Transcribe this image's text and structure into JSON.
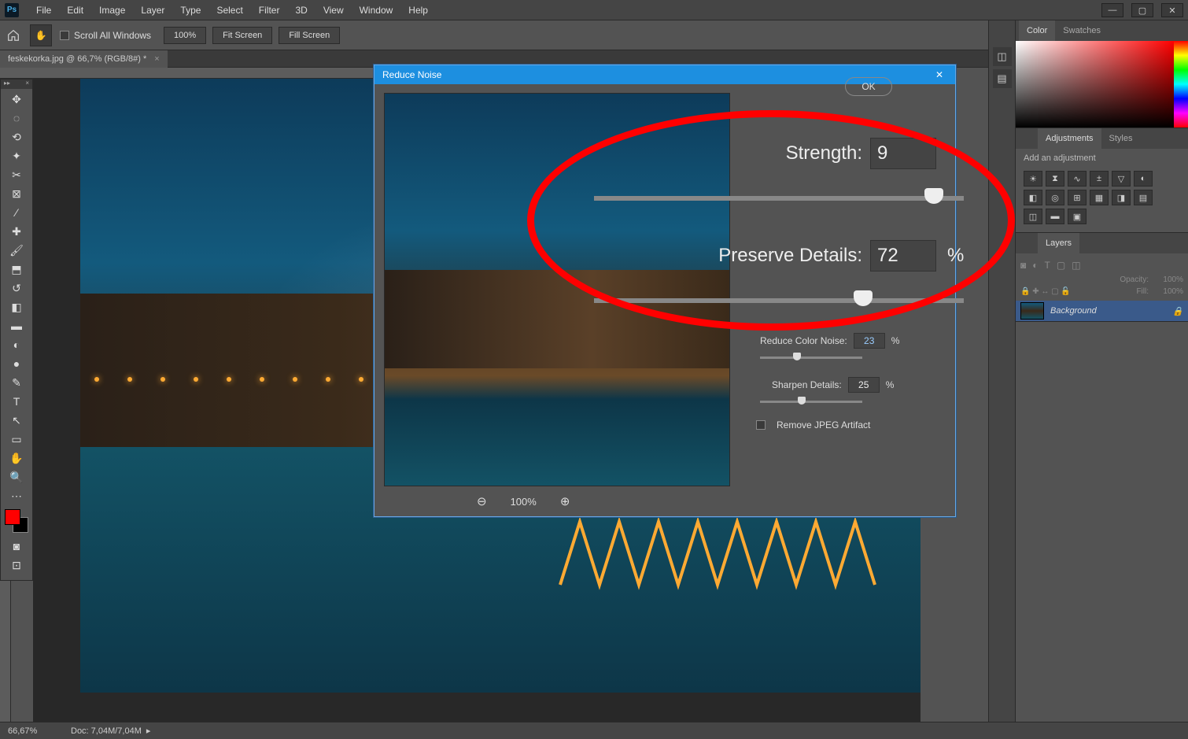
{
  "menu": {
    "items": [
      "File",
      "Edit",
      "Image",
      "Layer",
      "Type",
      "Select",
      "Filter",
      "3D",
      "View",
      "Window",
      "Help"
    ]
  },
  "options": {
    "scroll_all": "Scroll All Windows",
    "zoom": "100%",
    "fit": "Fit Screen",
    "fill": "Fill Screen"
  },
  "doc": {
    "tab": "feskekorka.jpg @ 66,7% (RGB/8#) *"
  },
  "dialog": {
    "title": "Reduce Noise",
    "ok": "OK",
    "strength_label": "Strength:",
    "strength_val": "9",
    "preserve_label": "Preserve Details:",
    "preserve_val": "72",
    "preserve_unit": "%",
    "colornoise_label": "Reduce Color Noise:",
    "colornoise_val": "23",
    "colornoise_unit": "%",
    "sharpen_label": "Sharpen Details:",
    "sharpen_val": "25",
    "sharpen_unit": "%",
    "removejpeg": "Remove JPEG Artifact",
    "zoom": "100%"
  },
  "panels": {
    "color": "Color",
    "swatches": "Swatches",
    "adjustments": "Adjustments",
    "styles": "Styles",
    "add_adjustment": "Add an adjustment",
    "layers": "Layers",
    "opacity_label": "Opacity:",
    "opacity_val": "100%",
    "fill_label": "Fill:",
    "fill_val": "100%",
    "bg_layer": "Background"
  },
  "status": {
    "zoom": "66,67%",
    "doc": "Doc: 7,04M/7,04M"
  }
}
